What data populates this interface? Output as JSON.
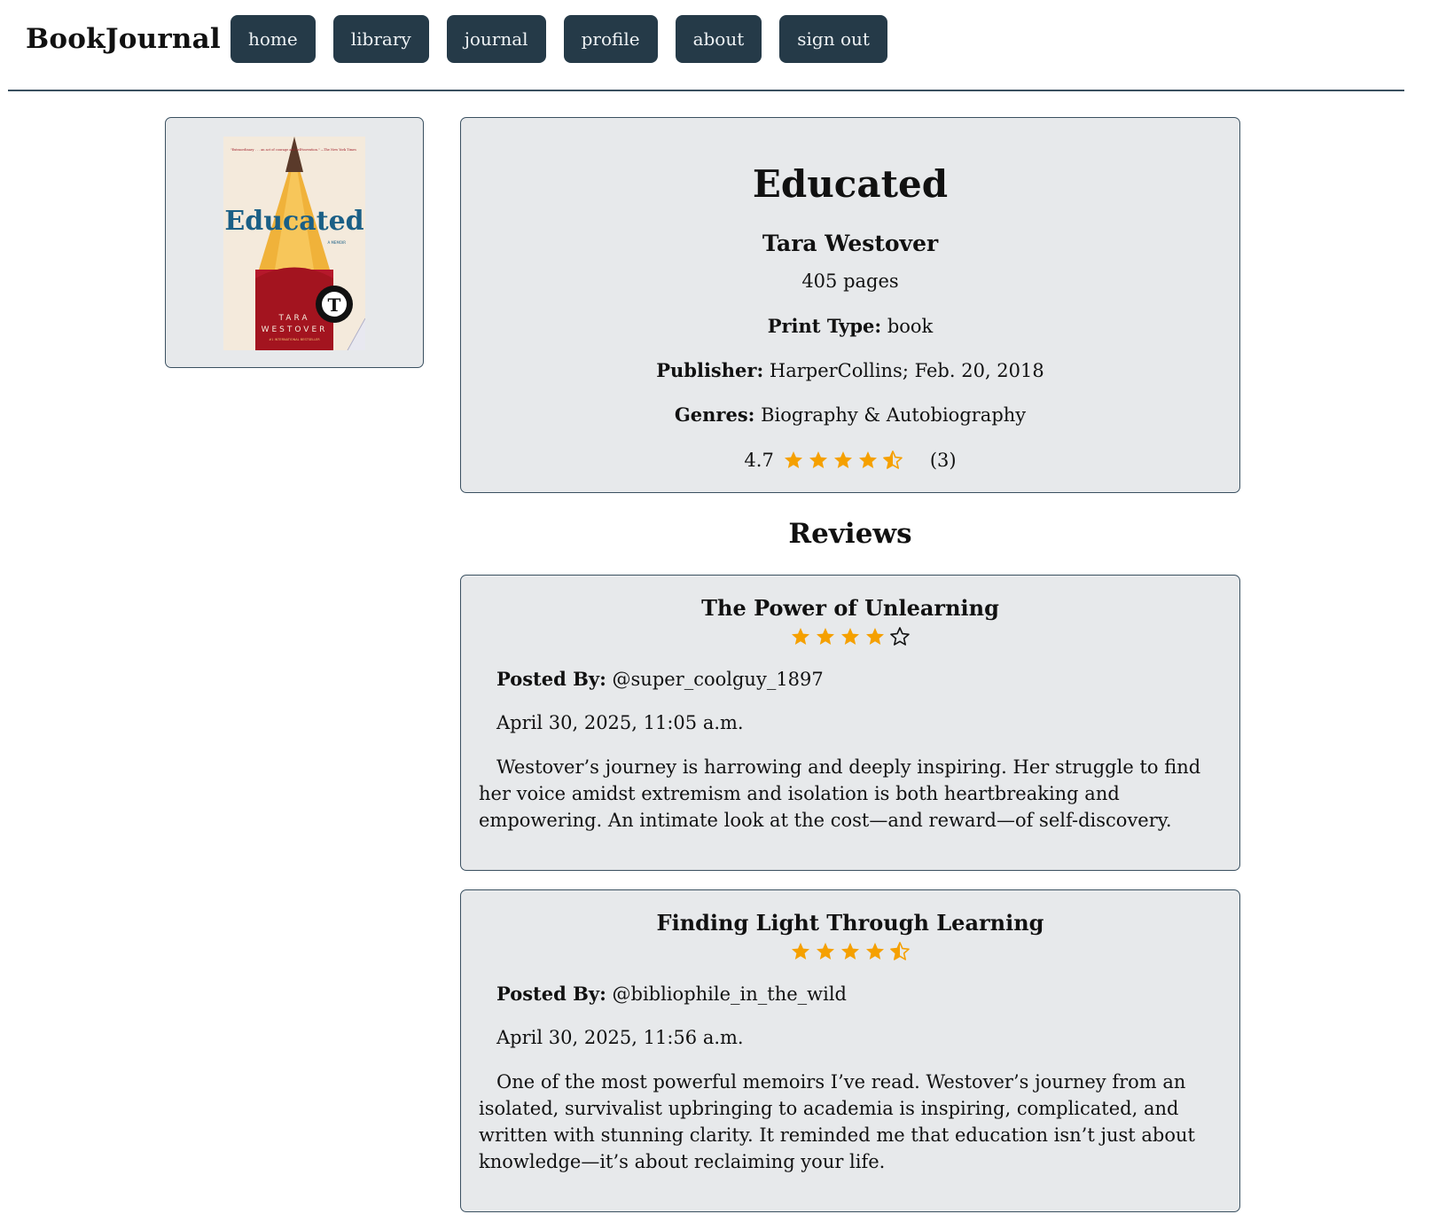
{
  "header": {
    "brand": "BookJournal",
    "nav": [
      "home",
      "library",
      "journal",
      "profile",
      "about",
      "sign out"
    ]
  },
  "book": {
    "title": "Educated",
    "author": "Tara Westover",
    "pages": "405 pages",
    "print_type_label": "Print Type:",
    "print_type": "book",
    "publisher_label": "Publisher:",
    "publisher": "HarperCollins; Feb. 20, 2018",
    "genres_label": "Genres:",
    "genres": "Biography & Autobiography",
    "rating": "4.7",
    "rating_value": 4.5,
    "rating_count": "(3)",
    "cover": {
      "title": "Educated",
      "subtitle": "A MEMOIR",
      "author_line1": "TARA",
      "author_line2": "WESTOVER",
      "quote": "\"Extraordinary . . . an act of courage and self-invention.\" —The New York Times",
      "badge": "#1 INTERNATIONAL BESTSELLER"
    }
  },
  "reviews_heading": "Reviews",
  "reviews": [
    {
      "title": "The Power of Unlearning",
      "rating": 4,
      "posted_by_label": "Posted By:",
      "user": "@super_coolguy_1897",
      "date": "April 30, 2025, 11:05 a.m.",
      "body": "Westover’s journey is harrowing and deeply inspiring. Her struggle to find her voice amidst extremism and isolation is both heartbreaking and empowering. An intimate look at the cost—and reward—of self-discovery."
    },
    {
      "title": "Finding Light Through Learning",
      "rating": 4.5,
      "posted_by_label": "Posted By:",
      "user": "@bibliophile_in_the_wild",
      "date": "April 30, 2025, 11:56 a.m.",
      "body": "One of the most powerful memoirs I’ve read. Westover’s journey from an isolated, survivalist upbringing to academia is inspiring, complicated, and written with stunning clarity. It reminded me that education isn’t just about knowledge—it’s about reclaiming your life."
    }
  ],
  "colors": {
    "nav_bg": "#253a48",
    "card_bg": "#e7e9eb",
    "border": "#3a5060",
    "star": "#f5a000"
  }
}
